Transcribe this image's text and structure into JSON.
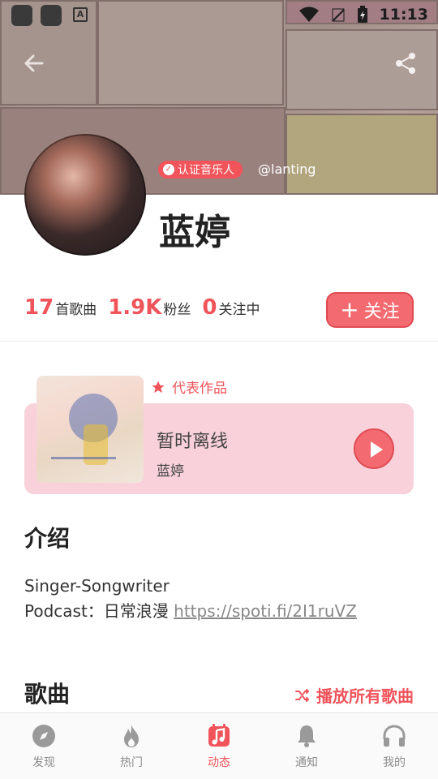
{
  "status_bar": {
    "time": "11:13",
    "app_icon_letter": "A"
  },
  "header": {
    "back_icon": "arrow-left-icon",
    "share_icon": "share-icon"
  },
  "profile": {
    "verified_badge": "认证音乐人",
    "handle": "@lanting",
    "name": "蓝婷",
    "stats": [
      {
        "value": "17",
        "label": "首歌曲"
      },
      {
        "value": "1.9K",
        "label": "粉丝"
      },
      {
        "value": "0",
        "label": "关注中"
      }
    ],
    "follow_label": "关注"
  },
  "featured": {
    "label": "代表作品",
    "title": "暂时离线",
    "artist": "蓝婷"
  },
  "intro": {
    "heading": "介绍",
    "line1": "Singer-Songwriter",
    "line2_prefix": "Podcast：日常浪漫 ",
    "link": "https://spoti.fi/2I1ruVZ"
  },
  "songs": {
    "heading": "歌曲",
    "play_all": "播放所有歌曲"
  },
  "bottom_nav": [
    {
      "label": "发现",
      "icon": "compass-icon",
      "active": false
    },
    {
      "label": "热门",
      "icon": "flame-icon",
      "active": false
    },
    {
      "label": "动态",
      "icon": "music-note-icon",
      "active": true
    },
    {
      "label": "通知",
      "icon": "bell-icon",
      "active": false
    },
    {
      "label": "我的",
      "icon": "headphones-icon",
      "active": false
    }
  ],
  "colors": {
    "accent": "#f0545b",
    "accent_light": "#f8d1da",
    "nav_inactive": "#8b8b8b"
  }
}
